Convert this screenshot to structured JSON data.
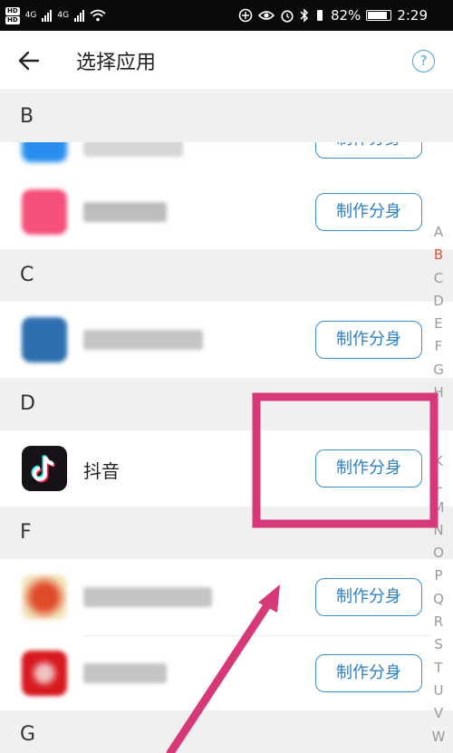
{
  "status_bar": {
    "hd_badges": [
      "HD",
      "HD"
    ],
    "network_labels": [
      "4G",
      "4G"
    ],
    "battery_percent": "82%",
    "time": "2:29"
  },
  "header": {
    "title": "选择应用",
    "help_label": "?"
  },
  "sections": [
    "B",
    "C",
    "D",
    "F",
    "G"
  ],
  "app_rows": [
    {
      "name": "",
      "button_label": "制作分身",
      "icon_color": "#2a8ef0"
    },
    {
      "name": "",
      "button_label": "制作分身",
      "icon_color": "#f4507a"
    },
    {
      "name": "",
      "button_label": "制作分身",
      "icon_color": "#2e6fb0"
    },
    {
      "name": "抖音",
      "button_label": "制作分身",
      "icon_color": "#161217"
    },
    {
      "name": "",
      "button_label": "制作分身",
      "icon_color": "#e04b2a"
    },
    {
      "name": "",
      "button_label": "制作分身",
      "icon_color": "#d71920"
    }
  ],
  "alphabet_index": [
    "A",
    "B",
    "C",
    "D",
    "E",
    "F",
    "G",
    "H",
    "",
    "",
    "K",
    "L",
    "M",
    "N",
    "O",
    "P",
    "Q",
    "R",
    "S",
    "T",
    "U",
    "V",
    "W"
  ],
  "active_index_letter": "B",
  "colors": {
    "accent_blue": "#3b8ed0",
    "annotation_pink": "#d63878",
    "index_active": "#e0533d"
  }
}
